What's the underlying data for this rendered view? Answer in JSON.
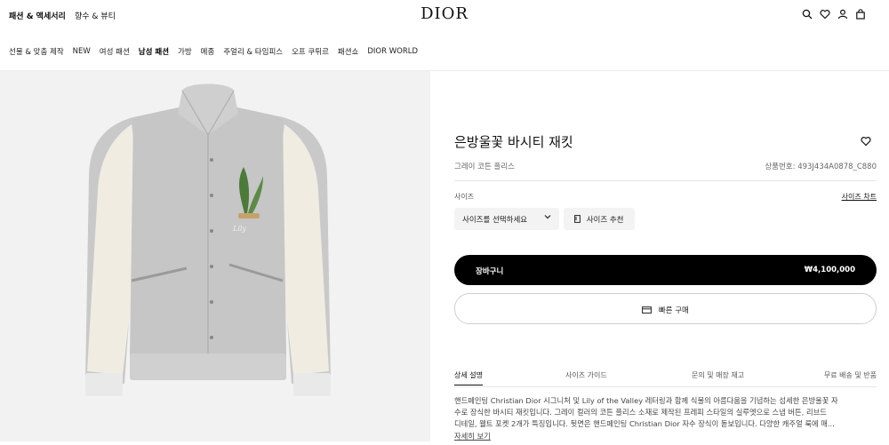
{
  "header": {
    "links": [
      "패션 & 액세서리",
      "향수 & 뷰티"
    ],
    "logo": "DIOR",
    "icons": [
      "search-icon",
      "heart-icon",
      "account-icon",
      "bag-icon"
    ]
  },
  "nav": {
    "items": [
      "선물 & 맞춤 제작",
      "NEW",
      "여성 패션",
      "남성 패션",
      "가방",
      "메종",
      "주얼리 & 타임피스",
      "오프 쿠튀르",
      "패션쇼",
      "DIOR WORLD"
    ],
    "active": "남성 패션"
  },
  "product": {
    "title": "은방울꽃 바시티 재킷",
    "subtitle": "그레이 코튼 플리스",
    "sku": "상품번호: 493J434A0878_C880",
    "size_label": "사이즈",
    "size_chart": "사이즈 차트",
    "size_select": "사이즈를 선택하세요",
    "size_reco": "사이즈 추천",
    "cart_label": "장바구니",
    "price": "₩4,100,000",
    "buy_now": "빠른 구매"
  },
  "tabs": [
    "상세 설명",
    "사이즈 가이드",
    "문의 및 매장 재고",
    "무료 배송 및 반품"
  ],
  "description": {
    "lines": [
      "핸드페인팅 Christian Dior 시그니처 및 Lily of the Valley 레터링과 함께 식물의 아름다움을 기념하는 섬세한 은방울꽃 자",
      "수로 장식한 바시티 재킷입니다. 그레이 컬러의 코튼 플리스 소재로 제작된 프레피 스타일의 실루엣으로 스냅 버튼, 리브드",
      "디테일, 웰트 포켓 2개가 특징입니다. 뒷면은 핸드페인팅 Christian Dior 자수 장식이 돋보입니다. 다양한 캐주얼 룩에 매..."
    ],
    "more": "자세히 보기"
  },
  "colors": {
    "jacket_body": "#c8c8c8",
    "sleeve": "#f1ede3",
    "button": "#000000"
  }
}
